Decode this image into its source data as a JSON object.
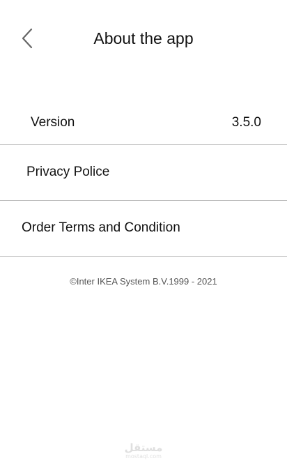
{
  "header": {
    "title": "About the app",
    "back_icon": "chevron-left-icon"
  },
  "rows": [
    {
      "label": "Version",
      "value": "3.5.0"
    },
    {
      "label": "Privacy Police"
    },
    {
      "label": "Order Terms and Condition"
    }
  ],
  "footer": {
    "copyright": "©Inter IKEA System B.V.1999 - 2021"
  },
  "watermark": {
    "logo_text": "مستقل",
    "domain": "mostaql.com"
  },
  "colors": {
    "background": "#ffffff",
    "text": "#111111",
    "divider": "#bdbdbd",
    "muted_text": "#555555",
    "icon": "#666666"
  }
}
